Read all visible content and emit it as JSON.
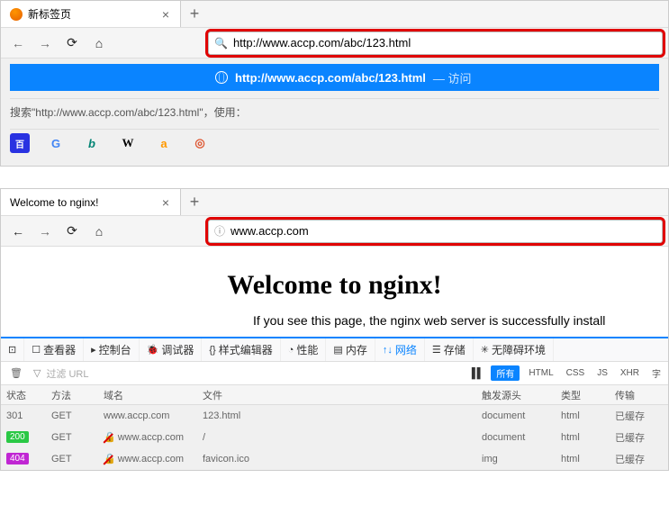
{
  "browser1": {
    "tab_title": "新标签页",
    "url": "http://www.accp.com/abc/123.html",
    "suggest_url": "http://www.accp.com/abc/123.html",
    "suggest_action": "访问",
    "search_hint_prefix": "搜索\"",
    "search_hint_url": "http://www.accp.com/abc/123.html",
    "search_hint_suffix": "\"，使用：",
    "engines": {
      "baidu": "百",
      "google": "G",
      "bing": "b",
      "wiki": "W",
      "amazon": "a",
      "ddg": "◎"
    }
  },
  "browser2": {
    "tab_title": "Welcome to nginx!",
    "url": "www.accp.com",
    "page_heading": "Welcome to nginx!",
    "page_desc": "If you see this page, the nginx web server is successfully install"
  },
  "devtools": {
    "panels": {
      "picker": "⟀",
      "inspector": "查看器",
      "console": "控制台",
      "debugger": "调试器",
      "style": "样式编辑器",
      "perf": "性能",
      "memory": "内存",
      "network": "网络",
      "storage": "存储",
      "a11y": "无障碍环境"
    },
    "filter_placeholder": "过滤 URL",
    "filter_all": "所有",
    "ftypes": [
      "HTML",
      "CSS",
      "JS",
      "XHR",
      "字"
    ],
    "cols": {
      "status": "状态",
      "method": "方法",
      "domain": "域名",
      "file": "文件",
      "cause": "触发源头",
      "type": "类型",
      "trans": "传输"
    },
    "rows": [
      {
        "status": "301",
        "method": "GET",
        "domain": "www.accp.com",
        "file": "123.html",
        "cause": "document",
        "type": "html",
        "trans": "已缓存",
        "badge": ""
      },
      {
        "status": "200",
        "method": "GET",
        "domain": "www.accp.com",
        "file": "/",
        "cause": "document",
        "type": "html",
        "trans": "已缓存",
        "badge": "b200",
        "insecure": true
      },
      {
        "status": "404",
        "method": "GET",
        "domain": "www.accp.com",
        "file": "favicon.ico",
        "cause": "img",
        "type": "html",
        "trans": "已缓存",
        "badge": "b404",
        "insecure": true
      }
    ]
  }
}
